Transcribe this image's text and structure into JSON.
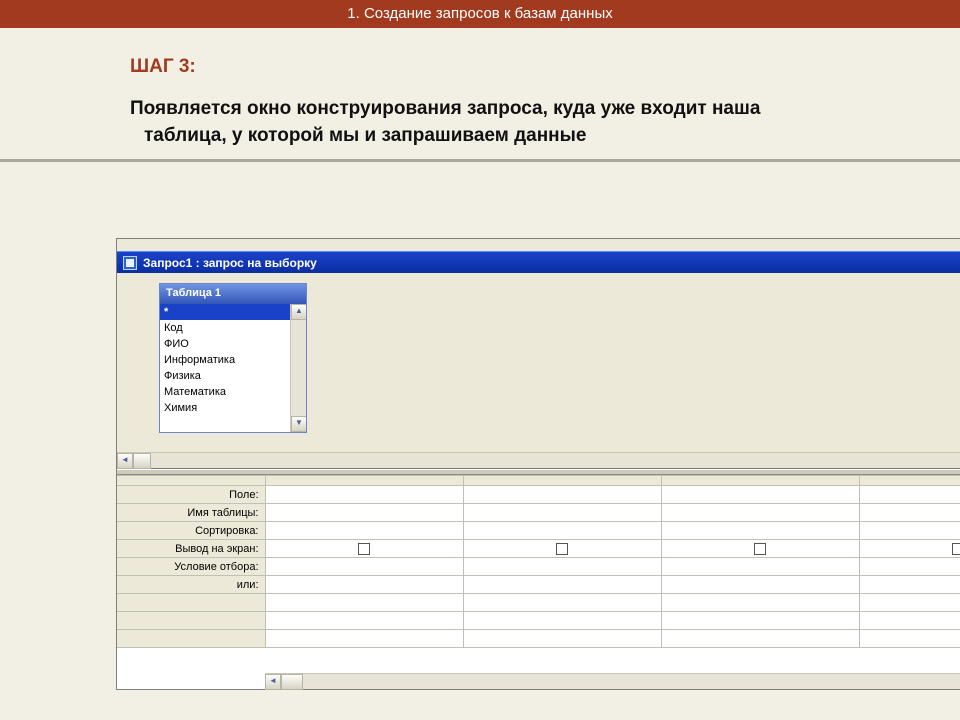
{
  "slide": {
    "header_title": "1. Создание запросов к базам данных",
    "step_label": "ШАГ 3:",
    "body_text": "Появляется окно конструирования запроса, куда уже входит наша таблица, у которой мы и запрашиваем данные"
  },
  "access_window": {
    "title": "Запрос1 : запрос на выборку",
    "table_box_title": "Таблица 1",
    "fields": [
      "*",
      "Код",
      "ФИО",
      "Информатика",
      "Физика",
      "Математика",
      "Химия"
    ],
    "selected_field_index": 0,
    "grid_row_labels": {
      "field": "Поле:",
      "table": "Имя таблицы:",
      "sort": "Сортировка:",
      "show": "Вывод на экран:",
      "criteria": "Условие отбора:",
      "or": "или:"
    }
  }
}
